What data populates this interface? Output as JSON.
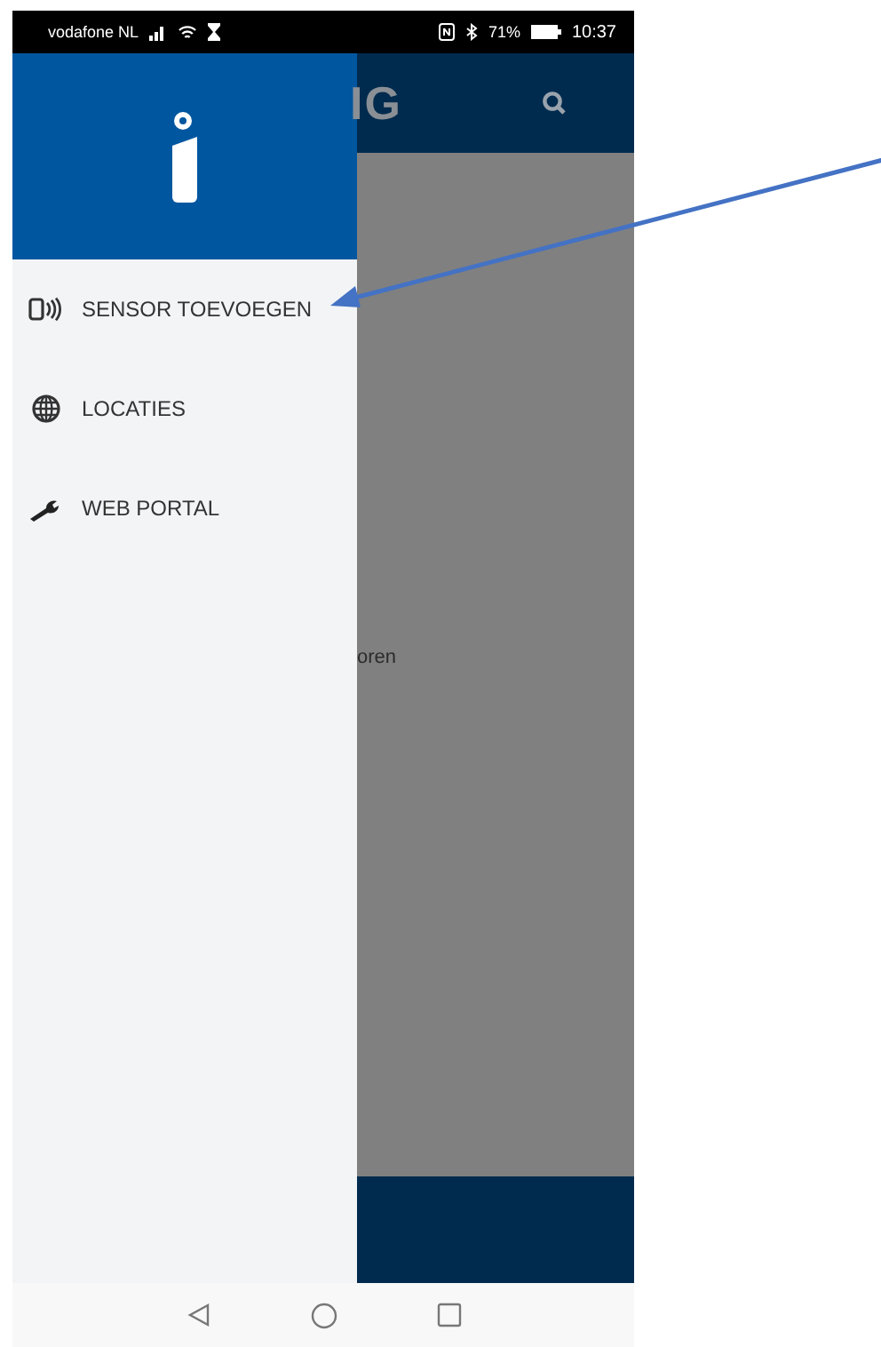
{
  "status_bar": {
    "carrier": "vodafone NL",
    "battery": "71%",
    "time": "10:37"
  },
  "app_bar": {
    "title": "IG"
  },
  "content": {
    "text": "oren"
  },
  "drawer": {
    "items": [
      {
        "kind": "sensor",
        "label": "SENSOR TOEVOEGEN",
        "selected": false
      },
      {
        "kind": "globe",
        "label": "LOCATIES",
        "selected": false
      },
      {
        "kind": "wrench",
        "label": "WEB PORTAL",
        "selected": false
      }
    ]
  },
  "annotation": {
    "kind": "arrow"
  }
}
